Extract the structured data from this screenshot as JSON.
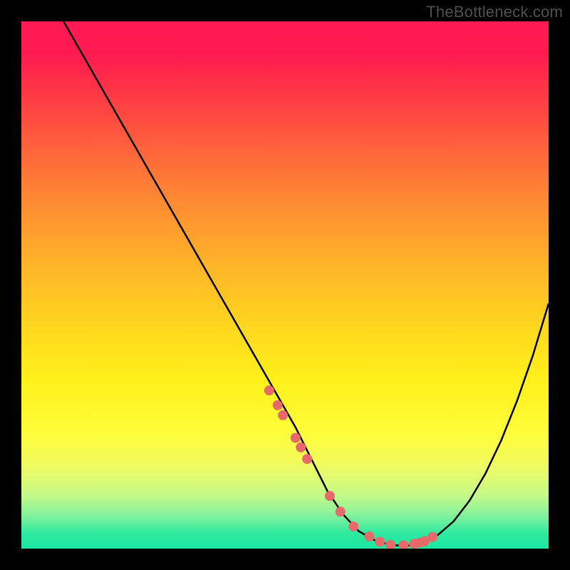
{
  "watermark": "TheBottleneck.com",
  "colors": {
    "background": "#000000",
    "top_gradient": "#ff1a55",
    "mid_gradient": "#ffe030",
    "bottom_gradient": "#19e7a0",
    "curve": "#000000",
    "dot": "#e66a6a"
  },
  "chart_data": {
    "type": "line",
    "title": "",
    "xlabel": "",
    "ylabel": "",
    "xlim": [
      0,
      100
    ],
    "ylim": [
      0,
      100
    ],
    "grid": false,
    "series": [
      {
        "name": "curve",
        "x": [
          8,
          12,
          16,
          20,
          24,
          28,
          32,
          36,
          40,
          44,
          48,
          52,
          55,
          58,
          61,
          64,
          67,
          70,
          73,
          76,
          79,
          82,
          85,
          88,
          91,
          94,
          97,
          100
        ],
        "y": [
          100,
          93,
          86,
          79,
          72,
          65,
          58,
          51,
          44,
          37,
          30,
          23,
          17,
          11,
          6.5,
          3.3,
          1.6,
          0.7,
          0.5,
          1.1,
          2.6,
          5.2,
          9.1,
          14.2,
          20.5,
          28.0,
          36.6,
          46.5
        ]
      }
    ],
    "dots": {
      "name": "markers",
      "x": [
        47.0,
        48.6,
        49.6,
        52.0,
        53.0,
        54.2,
        58.5,
        60.5,
        63.0,
        66.0,
        68.0,
        70.0,
        72.5,
        74.5,
        75.5,
        76.5,
        78.0
      ],
      "y": [
        30.0,
        27.2,
        25.3,
        21.0,
        19.2,
        17.0,
        10.0,
        7.0,
        4.2,
        2.3,
        1.3,
        0.7,
        0.6,
        0.9,
        1.1,
        1.4,
        2.2
      ]
    },
    "annotations": []
  }
}
